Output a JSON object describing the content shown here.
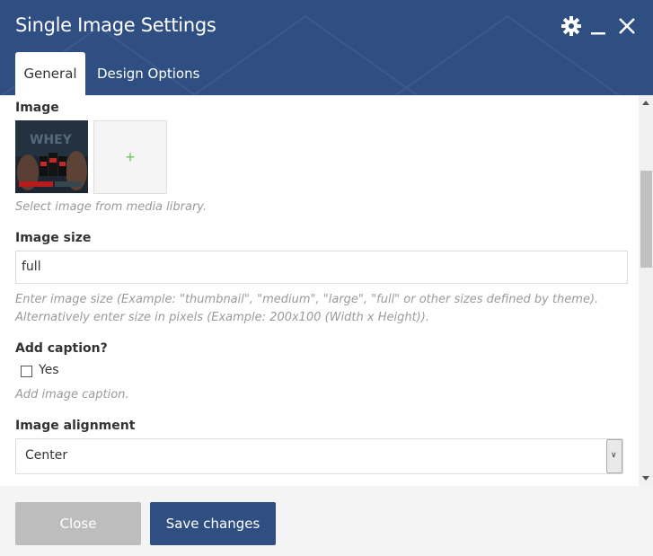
{
  "header": {
    "title": "Single Image Settings",
    "bg_color": "#2f4f82",
    "icons": [
      "gear-icon",
      "minimize-icon",
      "close-icon"
    ]
  },
  "tabs": [
    {
      "label": "General",
      "active": true
    },
    {
      "label": "Design Options",
      "active": false
    }
  ],
  "fields": {
    "image": {
      "label": "Image",
      "add_symbol": "+",
      "help": "Select image from media library."
    },
    "image_size": {
      "label": "Image size",
      "value": "full",
      "help_line1": "Enter image size (Example: \"thumbnail\", \"medium\", \"large\", \"full\" or other sizes defined by theme).",
      "help_line2": "Alternatively enter size in pixels (Example: 200x100 (Width x Height))."
    },
    "add_caption": {
      "label": "Add caption?",
      "option": "Yes",
      "checked": false,
      "help": "Add image caption."
    },
    "image_alignment": {
      "label": "Image alignment",
      "value": "Center"
    }
  },
  "footer": {
    "close_label": "Close",
    "save_label": "Save changes"
  },
  "colors": {
    "primary": "#2f4f82",
    "disabled": "#bdbdbd",
    "plus": "#6fc35a"
  }
}
